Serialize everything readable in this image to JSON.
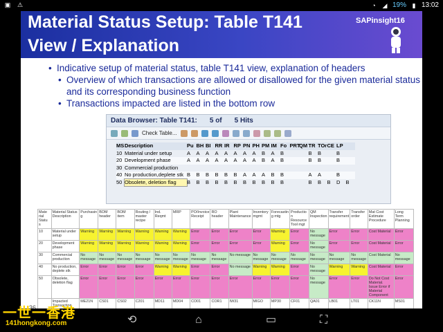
{
  "status_bar": {
    "battery": "19%",
    "time": "13:02"
  },
  "slide": {
    "title_line1": "Material Status Setup: Table T141",
    "title_line2": "View / Explanation",
    "brand": "SAPinsight16",
    "bullets": [
      "Indicative setup of material status, table T141 view, explanation of headers",
      "Overview of which transactions are allowed or disallowed for the given material status and its corresponding business function",
      "Transactions impacted are listed in the bottom row"
    ],
    "page_number": "36"
  },
  "sap_browser": {
    "title": "Data Browser: Table T141:",
    "count": "5 of",
    "hits": "5 Hits",
    "check_table_label": "Check Table...",
    "columns": [
      "MS",
      "Description",
      "Pu",
      "BH",
      "BI",
      "RR",
      "IR",
      "RP",
      "PN",
      "PH",
      "PM",
      "IM",
      "Fo",
      "PRT",
      "QM",
      "TR",
      "TOr",
      "CE",
      "LP"
    ],
    "rows": [
      {
        "ms": "10",
        "desc": "Material under setup",
        "flags": [
          "A",
          "A",
          "A",
          "A",
          "A",
          "A",
          "A",
          "A",
          "B",
          "A",
          "B",
          "",
          "",
          "B",
          "B",
          "",
          "B",
          ""
        ]
      },
      {
        "ms": "20",
        "desc": "Development phase",
        "flags": [
          "A",
          "A",
          "A",
          "A",
          "A",
          "A",
          "A",
          "A",
          "B",
          "A",
          "B",
          "",
          "",
          "B",
          "B",
          "",
          "B",
          ""
        ]
      },
      {
        "ms": "30",
        "desc": "Commercial production",
        "flags": [
          "",
          "",
          "",
          "",
          "",
          "",
          "",
          "",
          "",
          "",
          "",
          "",
          "",
          "",
          "",
          "",
          "",
          ""
        ]
      },
      {
        "ms": "40",
        "desc": "No production,deplete stk",
        "flags": [
          "B",
          "B",
          "B",
          "B",
          "B",
          "B",
          "A",
          "A",
          "A",
          "B",
          "B",
          "",
          "",
          "A",
          "A",
          "",
          "B",
          ""
        ]
      },
      {
        "ms": "50",
        "desc": "Obsolete, deletion flag",
        "flags": [
          "B",
          "B",
          "B",
          "B",
          "B",
          "B",
          "B",
          "B",
          "B",
          "B",
          "B",
          "",
          "",
          "B",
          "B",
          "B",
          "D",
          "B"
        ]
      }
    ]
  },
  "impact_table": {
    "headers": [
      "Mate rial Statu s",
      "Material Status Description",
      "Purchasin g",
      "BOM header",
      "BOM item",
      "Routing / master recipe",
      "Ind. Reqmt",
      "MRP",
      "PO/Invoice Receipt",
      "RO header",
      "Plant Maintenance",
      "Inventory mgmt",
      "Forecastin g mtg",
      "Productio n Resource Tool mgt",
      "QM Inspection",
      "Transfer requirement",
      "Transfer order",
      "Mat Cost Estimate Procedure",
      "Long Term Planning"
    ],
    "rows": [
      {
        "cells": [
          "10",
          "Material under setup",
          "Warning",
          "Warning",
          "Warning",
          "Warning",
          "Warning",
          "Warning",
          "Error",
          "Error",
          "Error",
          "Error",
          "Warning",
          "Error",
          "No message",
          "Error",
          "Error",
          "Cost Material",
          "Error"
        ],
        "kinds": [
          "",
          "",
          "w",
          "w",
          "w",
          "w",
          "w",
          "w",
          "e",
          "e",
          "e",
          "e",
          "w",
          "e",
          "n",
          "e",
          "e",
          "c",
          "e"
        ]
      },
      {
        "cells": [
          "20",
          "Development phase",
          "Warning",
          "Warning",
          "Warning",
          "Warning",
          "Warning",
          "Warning",
          "Error",
          "Error",
          "Error",
          "Error",
          "Warning",
          "Error",
          "No message",
          "Error",
          "Error",
          "Cost Material",
          "Error"
        ],
        "kinds": [
          "",
          "",
          "w",
          "w",
          "w",
          "w",
          "w",
          "w",
          "e",
          "e",
          "e",
          "e",
          "w",
          "e",
          "n",
          "e",
          "e",
          "c",
          "e"
        ]
      },
      {
        "cells": [
          "30",
          "Commercial production",
          "No message",
          "No message",
          "No message",
          "No message",
          "No message",
          "No message",
          "No message",
          "No message",
          "No message",
          "No message",
          "No message",
          "No message",
          "No message",
          "No message",
          "No message",
          "Cost Material",
          "No message"
        ],
        "kinds": [
          "",
          "",
          "n",
          "n",
          "n",
          "n",
          "n",
          "n",
          "n",
          "n",
          "n",
          "n",
          "n",
          "n",
          "n",
          "n",
          "n",
          "s",
          "n"
        ]
      },
      {
        "cells": [
          "40",
          "No production, deplete stk",
          "Error",
          "Error",
          "Error",
          "Error",
          "Warning",
          "Warning",
          "Error",
          "Error",
          "No message",
          "Warning",
          "Warning",
          "Error",
          "No message",
          "Warning",
          "Warning",
          "Cost Material",
          "Error"
        ],
        "kinds": [
          "",
          "",
          "e",
          "e",
          "e",
          "e",
          "w",
          "w",
          "e",
          "e",
          "n",
          "w",
          "w",
          "e",
          "n",
          "w",
          "w",
          "c",
          "e"
        ]
      },
      {
        "cells": [
          "50",
          "Obsolete, deletion flag",
          "Error",
          "Error",
          "Error",
          "Error",
          "Error",
          "Error",
          "Error",
          "Error",
          "Error",
          "Error",
          "Error",
          "Error",
          "No message",
          "Error",
          "Error",
          "Do Not Cost Material. Issue Error if Material Component",
          "Error"
        ],
        "kinds": [
          "",
          "",
          "e",
          "e",
          "e",
          "e",
          "e",
          "e",
          "e",
          "e",
          "e",
          "e",
          "e",
          "e",
          "n",
          "e",
          "e",
          "c",
          "e"
        ]
      }
    ],
    "impacted": [
      "",
      "Impacted Transaction",
      "ME21N",
      "CS01",
      "CS02",
      "C201",
      "MD11",
      "MD04",
      "CO01",
      "COR1",
      "IW31",
      "MIGO",
      "MP30",
      "CF01",
      "QA01",
      "LB01",
      "LT01",
      "CK11N",
      "MS01"
    ]
  },
  "watermark": {
    "line1": "一世一香港",
    "line2": "141hongkong.com"
  }
}
